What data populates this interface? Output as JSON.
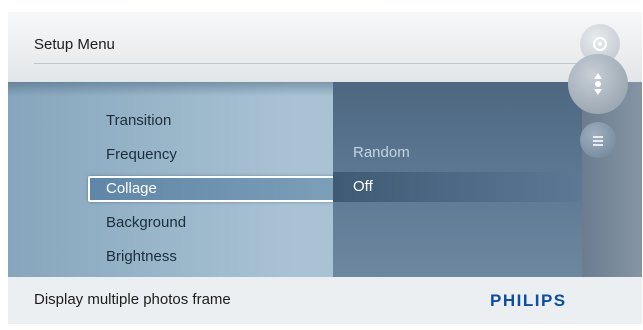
{
  "header": {
    "title": "Setup Menu"
  },
  "menu": {
    "items": [
      {
        "label": "Transition"
      },
      {
        "label": "Frequency"
      },
      {
        "label": "Collage"
      },
      {
        "label": "Background"
      },
      {
        "label": "Brightness"
      }
    ],
    "selected_index": 2
  },
  "options": {
    "items": [
      {
        "label": "Random"
      },
      {
        "label": "Off"
      }
    ],
    "active_index": 1
  },
  "footer": {
    "hint": "Display multiple photos frame",
    "brand": "PHILIPS"
  },
  "controls": {
    "icons": [
      "settings-icon",
      "navigation-icon",
      "menu-icon"
    ]
  },
  "colors": {
    "brand": "#0b4ea2",
    "selection_border": "#ffffff",
    "panel": "#5a7590"
  }
}
